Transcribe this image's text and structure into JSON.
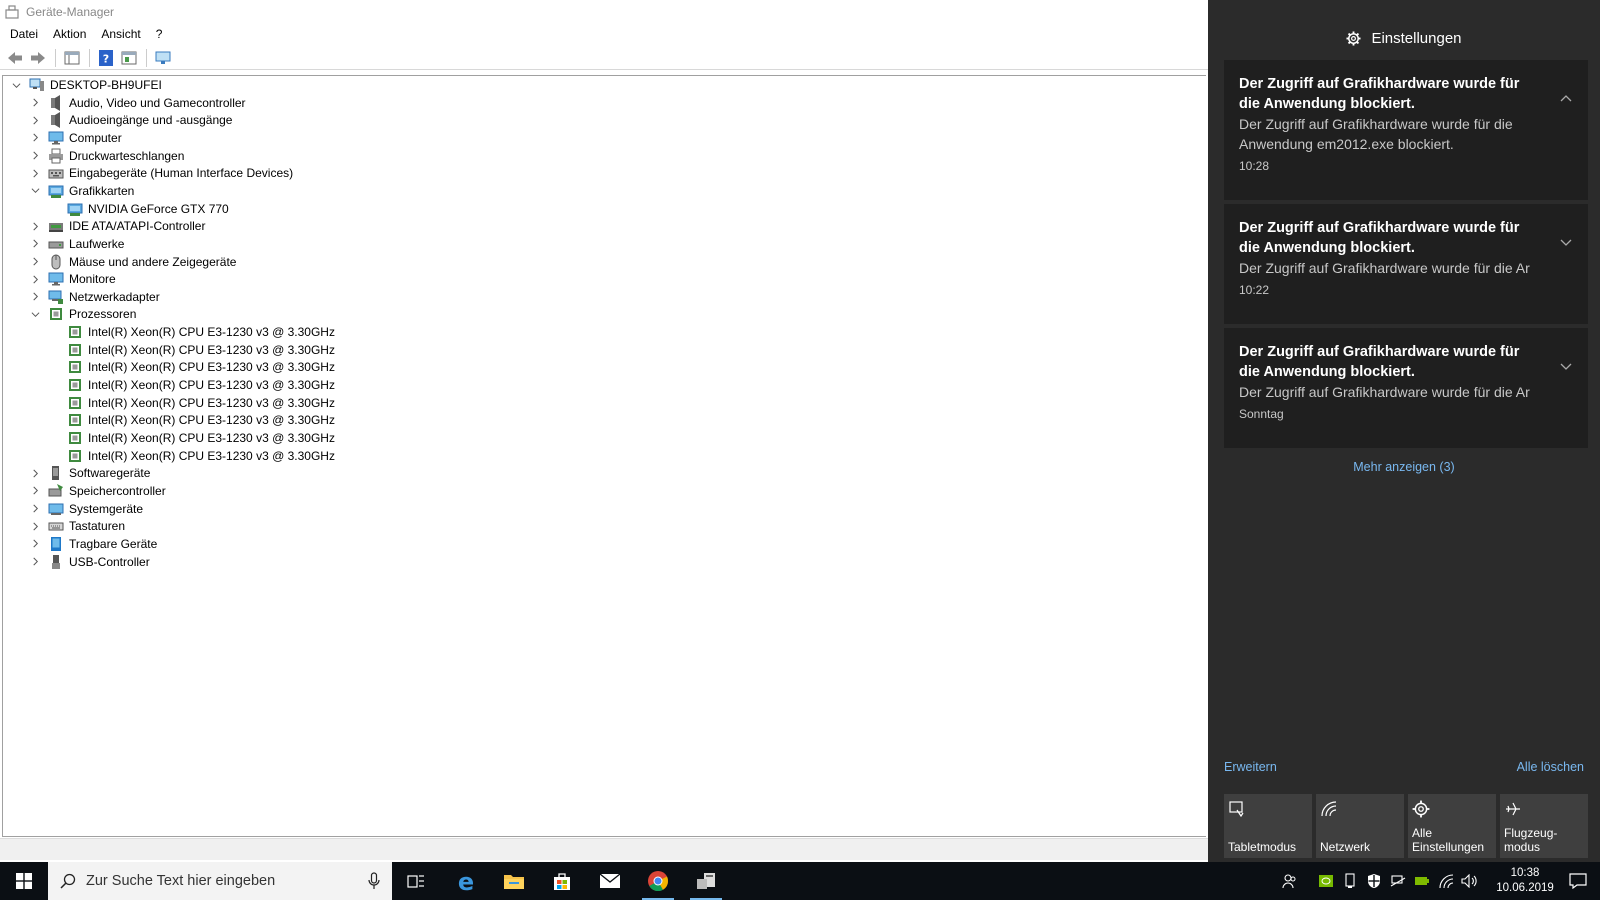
{
  "window": {
    "title": "Geräte-Manager"
  },
  "menu": [
    "Datei",
    "Aktion",
    "Ansicht",
    "?"
  ],
  "tree": {
    "root": "DESKTOP-BH9UFEI",
    "items": [
      {
        "label": "Audio, Video und Gamecontroller",
        "icon": "speaker-icon",
        "expanded": false
      },
      {
        "label": "Audioeingänge und -ausgänge",
        "icon": "speaker-icon",
        "expanded": false
      },
      {
        "label": "Computer",
        "icon": "monitor-icon",
        "expanded": false
      },
      {
        "label": "Druckwarteschlangen",
        "icon": "printer-icon",
        "expanded": false
      },
      {
        "label": "Eingabegeräte (Human Interface Devices)",
        "icon": "hid-icon",
        "expanded": false
      },
      {
        "label": "Grafikkarten",
        "icon": "display-adapter-icon",
        "expanded": true,
        "children": [
          "NVIDIA GeForce GTX 770"
        ],
        "child_icon": "display-adapter-icon"
      },
      {
        "label": "IDE ATA/ATAPI-Controller",
        "icon": "ide-controller-icon",
        "expanded": false
      },
      {
        "label": "Laufwerke",
        "icon": "drive-icon",
        "expanded": false
      },
      {
        "label": "Mäuse und andere Zeigegeräte",
        "icon": "mouse-icon",
        "expanded": false
      },
      {
        "label": "Monitore",
        "icon": "monitor-icon",
        "expanded": false
      },
      {
        "label": "Netzwerkadapter",
        "icon": "network-adapter-icon",
        "expanded": false
      },
      {
        "label": "Prozessoren",
        "icon": "processor-icon",
        "expanded": true,
        "children": [
          "Intel(R) Xeon(R) CPU E3-1230 v3 @ 3.30GHz",
          "Intel(R) Xeon(R) CPU E3-1230 v3 @ 3.30GHz",
          "Intel(R) Xeon(R) CPU E3-1230 v3 @ 3.30GHz",
          "Intel(R) Xeon(R) CPU E3-1230 v3 @ 3.30GHz",
          "Intel(R) Xeon(R) CPU E3-1230 v3 @ 3.30GHz",
          "Intel(R) Xeon(R) CPU E3-1230 v3 @ 3.30GHz",
          "Intel(R) Xeon(R) CPU E3-1230 v3 @ 3.30GHz",
          "Intel(R) Xeon(R) CPU E3-1230 v3 @ 3.30GHz"
        ],
        "child_icon": "processor-icon"
      },
      {
        "label": "Softwaregeräte",
        "icon": "software-device-icon",
        "expanded": false
      },
      {
        "label": "Speichercontroller",
        "icon": "storage-controller-icon",
        "expanded": false
      },
      {
        "label": "Systemgeräte",
        "icon": "system-device-icon",
        "expanded": false
      },
      {
        "label": "Tastaturen",
        "icon": "keyboard-icon",
        "expanded": false
      },
      {
        "label": "Tragbare Geräte",
        "icon": "portable-device-icon",
        "expanded": false
      },
      {
        "label": "USB-Controller",
        "icon": "usb-icon",
        "expanded": false
      }
    ]
  },
  "action_center": {
    "header": "Einstellungen",
    "notifications": [
      {
        "title": "Der Zugriff auf Grafikhardware wurde für die Anwendung blockiert.",
        "body": "Der Zugriff auf Grafikhardware wurde für die Anwendung em2012.exe blockiert.",
        "time": "10:28",
        "expanded": true
      },
      {
        "title": "Der Zugriff auf Grafikhardware wurde für die Anwendung blockiert.",
        "body": "Der Zugriff auf Grafikhardware wurde für die Ar",
        "time": "10:22",
        "expanded": false
      },
      {
        "title": "Der Zugriff auf Grafikhardware wurde für die Anwendung blockiert.",
        "body": "Der Zugriff auf Grafikhardware wurde für die Ar",
        "time": "Sonntag",
        "expanded": false
      }
    ],
    "more": "Mehr anzeigen (3)",
    "expand": "Erweitern",
    "clear_all": "Alle löschen",
    "quick_actions": [
      {
        "label": "Tabletmodus",
        "icon": "tablet-mode-icon"
      },
      {
        "label": "Netzwerk",
        "icon": "network-icon"
      },
      {
        "label": "Alle Einstellungen",
        "icon": "settings-gear-icon"
      },
      {
        "label": "Flugzeug-modus",
        "icon": "airplane-icon"
      }
    ]
  },
  "taskbar": {
    "search_placeholder": "Zur Suche Text hier eingeben",
    "time": "10:38",
    "date": "10.06.2019"
  },
  "colors": {
    "action_center_bg": "#2b2b2b",
    "card_bg": "#1f1f1f",
    "link": "#79b8f0",
    "quick_action_bg": "#3f3f3f",
    "taskbar_bg": "#0b0f14"
  }
}
